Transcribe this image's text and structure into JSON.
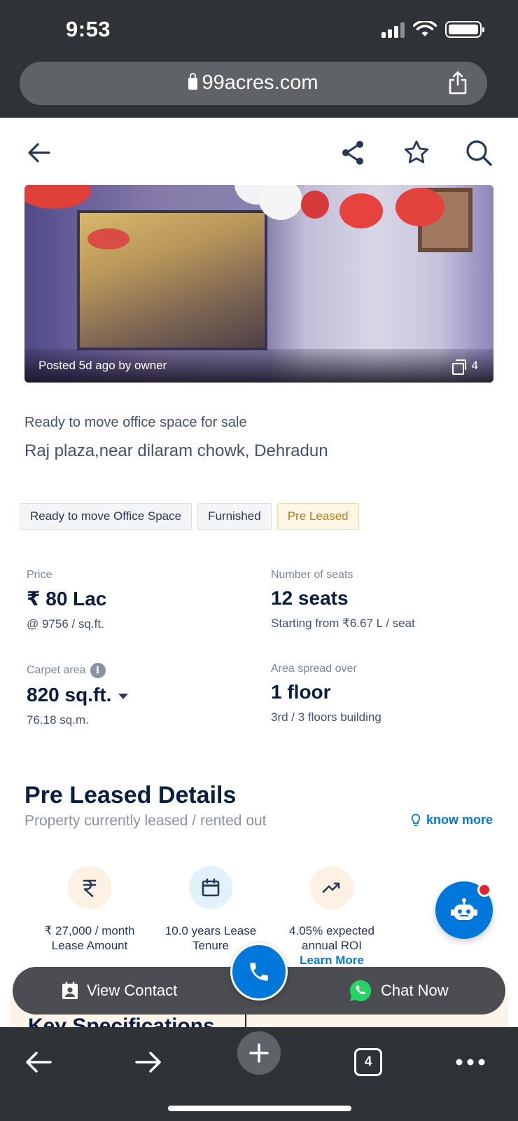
{
  "status": {
    "time": "9:53"
  },
  "browser": {
    "url": "99acres.com",
    "tab_count": "4"
  },
  "photo": {
    "caption": "Posted 5d ago by owner",
    "count": "4"
  },
  "listing": {
    "type": "Ready to move office space for sale",
    "address": "Raj plaza,near dilaram chowk, Dehradun",
    "tags": [
      "Ready to move Office Space",
      "Furnished",
      "Pre Leased"
    ]
  },
  "facts": {
    "price": {
      "label": "Price",
      "value": "₹ 80 Lac",
      "sub": "@ 9756 / sq.ft."
    },
    "seats": {
      "label": "Number of seats",
      "value": "12 seats",
      "sub": "Starting from ₹6.67 L / seat"
    },
    "carpet": {
      "label": "Carpet area",
      "value": "820 sq.ft.",
      "sub": "76.18 sq.m."
    },
    "floors": {
      "label": "Area spread over",
      "value": "1 floor",
      "sub": "3rd / 3 floors building"
    }
  },
  "pre_leased": {
    "title": "Pre Leased Details",
    "subtitle": "Property currently leased / rented out",
    "know_more": "know more",
    "items": [
      {
        "icon": "rupee-icon",
        "line1": "₹ 27,000 / month",
        "line2": "Lease Amount"
      },
      {
        "icon": "calendar-icon",
        "line1": "10.0 years Lease",
        "line2": "Tenure"
      },
      {
        "icon": "trending-up-icon",
        "line1": "4.05% expected",
        "line2": "annual ROI",
        "link": "Learn More"
      }
    ]
  },
  "cta": {
    "view_contact": "View Contact",
    "chat_now": "Chat Now"
  },
  "peek": {
    "text": "Key Specifications"
  },
  "colors": {
    "brand_blue": "#0078DB",
    "text_dark": "#091E42",
    "pre_leased": "#C27B15",
    "whatsapp": "#25D366"
  }
}
